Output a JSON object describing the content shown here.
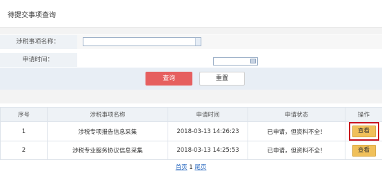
{
  "header": {
    "title": "待提交事项查询"
  },
  "form": {
    "name_label": "涉税事项名称：",
    "name_value": "",
    "date_label": "申请时间：",
    "date_value": "",
    "query_label": "查询",
    "reset_label": "重置"
  },
  "table": {
    "columns": [
      "序号",
      "涉税事项名称",
      "申请时间",
      "申请状态",
      "操作"
    ],
    "rows": [
      {
        "index": "1",
        "name": "涉税专项报告信息采集",
        "time": "2018-03-13 14:26:23",
        "status": "已申请，但资料不全！",
        "action": "查看"
      },
      {
        "index": "2",
        "name": "涉税专业服务协议信息采集",
        "time": "2018-03-13 14:25:53",
        "status": "已申请，但资料不全！",
        "action": "查看"
      }
    ]
  },
  "pager": {
    "first": "首页",
    "current": "1",
    "last": "尾页"
  },
  "colors": {
    "query_button": "#e65f5f",
    "view_button": "#f0c05a",
    "highlight_border": "#c8121e",
    "pager_link": "#2a6ac0"
  }
}
